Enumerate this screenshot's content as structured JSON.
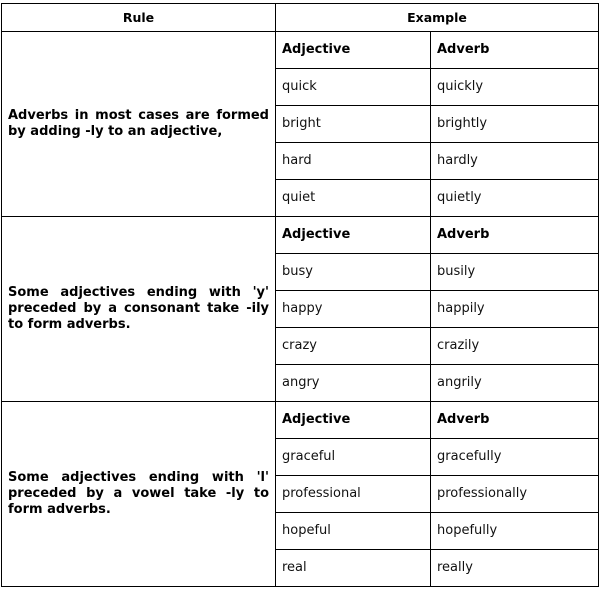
{
  "table": {
    "headers": {
      "rule": "Rule",
      "example": "Example"
    },
    "groups": [
      {
        "rule": "Adverbs in most cases are formed by adding -ly to an adjective,",
        "sub_headers": {
          "adjective": "Adjective",
          "adverb": "Adverb"
        },
        "pairs": [
          {
            "adjective": "quick",
            "adverb": "quickly"
          },
          {
            "adjective": "bright",
            "adverb": "brightly"
          },
          {
            "adjective": "hard",
            "adverb": "hardly"
          },
          {
            "adjective": "quiet",
            "adverb": "quietly"
          }
        ]
      },
      {
        "rule": "Some adjectives ending with 'y' preceded by a consonant take -ily to form adverbs.",
        "sub_headers": {
          "adjective": "Adjective",
          "adverb": "Adverb"
        },
        "pairs": [
          {
            "adjective": "busy",
            "adverb": "busily"
          },
          {
            "adjective": "happy",
            "adverb": "happily"
          },
          {
            "adjective": "crazy",
            "adverb": "crazily"
          },
          {
            "adjective": "angry",
            "adverb": "angrily"
          }
        ]
      },
      {
        "rule": "Some adjectives ending with 'l' preceded by a vowel take -ly to form adverbs.",
        "sub_headers": {
          "adjective": "Adjective",
          "adverb": "Adverb"
        },
        "pairs": [
          {
            "adjective": "graceful",
            "adverb": "gracefully"
          },
          {
            "adjective": "professional",
            "adverb": "professionally"
          },
          {
            "adjective": "hopeful",
            "adverb": "hopefully"
          },
          {
            "adjective": "real",
            "adverb": "really"
          }
        ]
      }
    ]
  }
}
